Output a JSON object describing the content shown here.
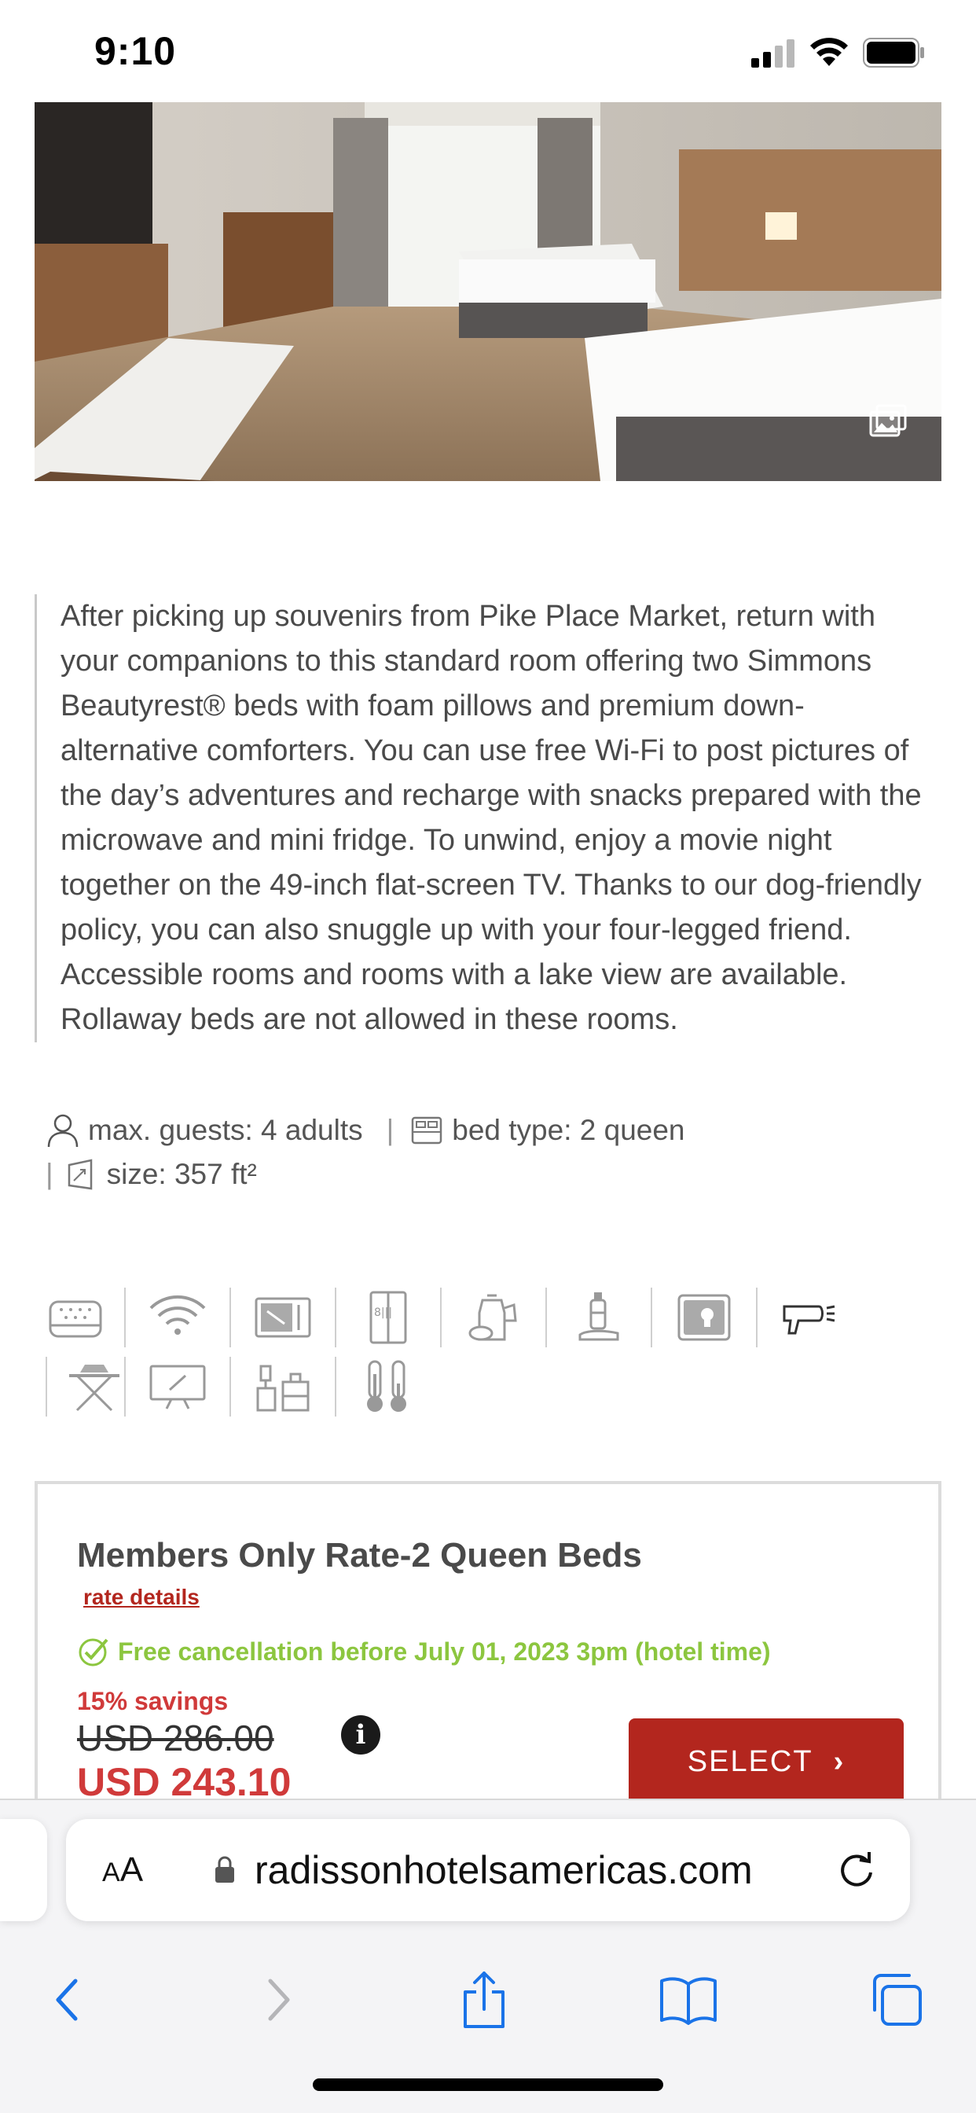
{
  "status_bar": {
    "time": "9:10"
  },
  "hero": {
    "alt": "Hotel room with two queen beds"
  },
  "description": "After picking up souvenirs from Pike Place Market, return with your companions to this standard room offering two Simmons Beautyrest® beds with foam pillows and premium down-alternative comforters. You can use free Wi-Fi to post pictures of the day’s adventures and recharge with snacks prepared with the microwave and mini fridge. To unwind, enjoy a movie night together on the 49-inch flat-screen TV. Thanks to our dog-friendly policy, you can also snuggle up with your four-legged friend. Accessible rooms and rooms with a lake view are available. Rollaway beds are not allowed in these rooms.",
  "specs": {
    "guests": "max. guests: 4 adults",
    "bed": "bed type: 2 queen",
    "size": "size: 357 ft²"
  },
  "amenities": [
    "mattress-icon",
    "wifi-icon",
    "microwave-icon",
    "fridge-icon",
    "kettle-icon",
    "toiletries-icon",
    "safe-icon",
    "hairdryer-icon",
    "iron-icon",
    "tv-icon",
    "desk-icon",
    "thermostat-icon"
  ],
  "rate": {
    "title": "Members Only Rate-2 Queen Beds",
    "details_link": "rate details",
    "cancellation": "Free cancellation before July 01, 2023 3pm (hotel time)",
    "savings": "15% savings",
    "old_price": "USD 286.00",
    "new_price": "USD 243.10",
    "select_label": "SELECT",
    "info": "i"
  },
  "browser": {
    "aa_label": "AA",
    "url": "radissonhotelsamericas.com"
  },
  "colors": {
    "accent": "#b3261e",
    "savings": "#d03a3a",
    "cancel_green": "#8cc63f",
    "ios_blue": "#1a73e8"
  }
}
